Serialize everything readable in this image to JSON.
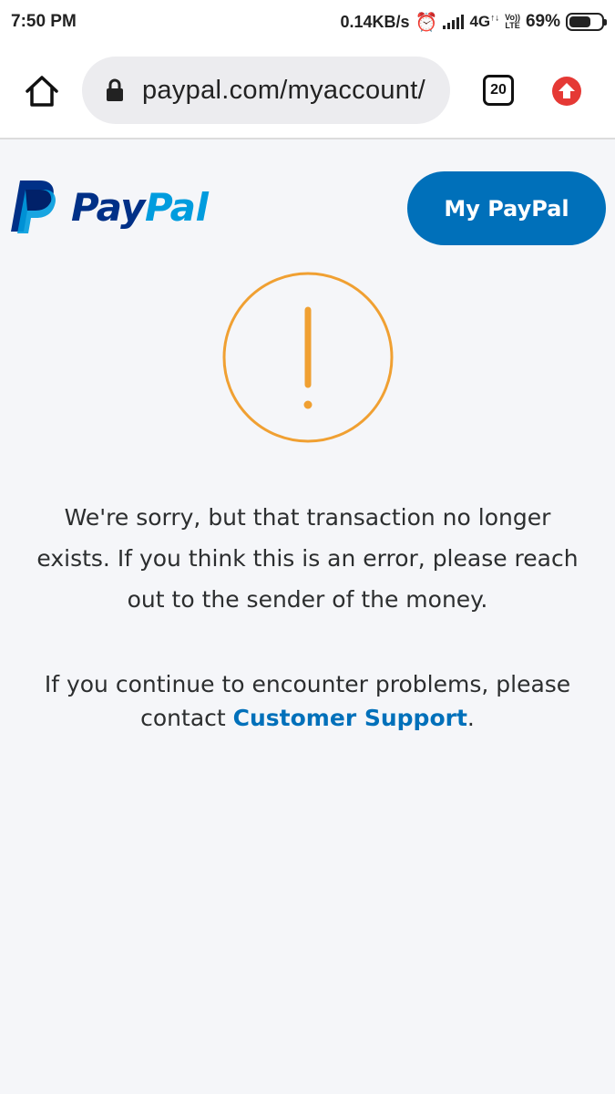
{
  "status_bar": {
    "time": "7:50 PM",
    "network_speed": "0.14KB/s",
    "network_type": "4G",
    "volte_top": "Vo))",
    "volte_bottom": "LTE",
    "battery_percent": "69%",
    "battery_level": 0.69
  },
  "browser": {
    "url": "paypal.com/myaccount/",
    "tab_count": "20"
  },
  "header": {
    "logo_pay": "Pay",
    "logo_pal": "Pal",
    "my_paypal_label": "My PayPal"
  },
  "main": {
    "error_message": "We're sorry, but that transaction no longer exists. If you think this is an error, please reach out to the sender of the money.",
    "contact_prefix": "If you continue to encounter problems, please contact ",
    "contact_link": "Customer Support",
    "contact_suffix": "."
  },
  "colors": {
    "brand_dark": "#003087",
    "brand_light": "#009cde",
    "button": "#0070ba",
    "warning": "#f0a032"
  }
}
